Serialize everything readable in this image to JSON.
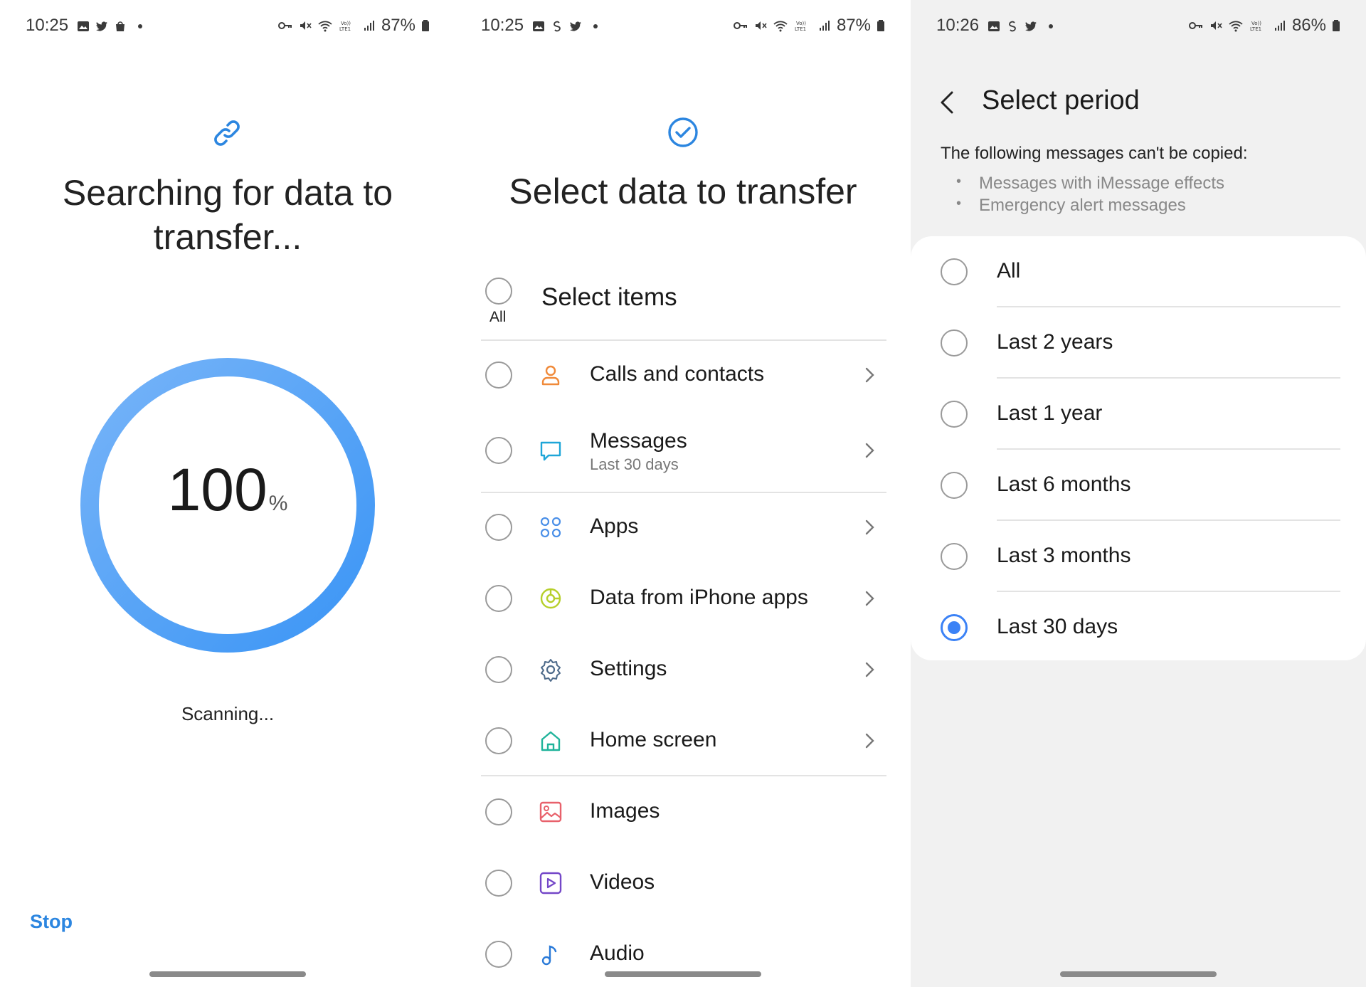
{
  "colors": {
    "accent": "#2c86e0",
    "selected_radio": "#3b82f6",
    "ring_gradient_start": "#77b4f8",
    "ring_gradient_end": "#3b95f5"
  },
  "panel1": {
    "status": {
      "time": "10:25",
      "battery": "87%"
    },
    "title": "Searching for data to transfer...",
    "progress": {
      "value": "100",
      "unit": "%"
    },
    "scanning": "Scanning...",
    "stop": "Stop"
  },
  "panel2": {
    "status": {
      "time": "10:25",
      "battery": "87%"
    },
    "title": "Select data to transfer",
    "all_label": "All",
    "select_items": "Select items",
    "items": [
      {
        "label": "Calls and contacts",
        "sub": "",
        "icon": "person-icon"
      },
      {
        "label": "Messages",
        "sub": "Last 30 days",
        "icon": "message-icon"
      },
      {
        "label": "Apps",
        "sub": "",
        "icon": "apps-icon"
      },
      {
        "label": "Data from iPhone apps",
        "sub": "",
        "icon": "iphone-data-icon"
      },
      {
        "label": "Settings",
        "sub": "",
        "icon": "gear-icon"
      },
      {
        "label": "Home screen",
        "sub": "",
        "icon": "home-icon"
      },
      {
        "label": "Images",
        "sub": "",
        "icon": "image-icon"
      },
      {
        "label": "Videos",
        "sub": "",
        "icon": "video-icon"
      },
      {
        "label": "Audio",
        "sub": "",
        "icon": "music-note-icon"
      }
    ]
  },
  "panel3": {
    "status": {
      "time": "10:26",
      "battery": "86%"
    },
    "title": "Select period",
    "note": "The following messages can't be copied:",
    "bullets": [
      "Messages with iMessage effects",
      "Emergency alert messages"
    ],
    "options": [
      "All",
      "Last 2 years",
      "Last 1 year",
      "Last 6 months",
      "Last 3 months",
      "Last 30 days"
    ],
    "selected": "Last 30 days"
  }
}
